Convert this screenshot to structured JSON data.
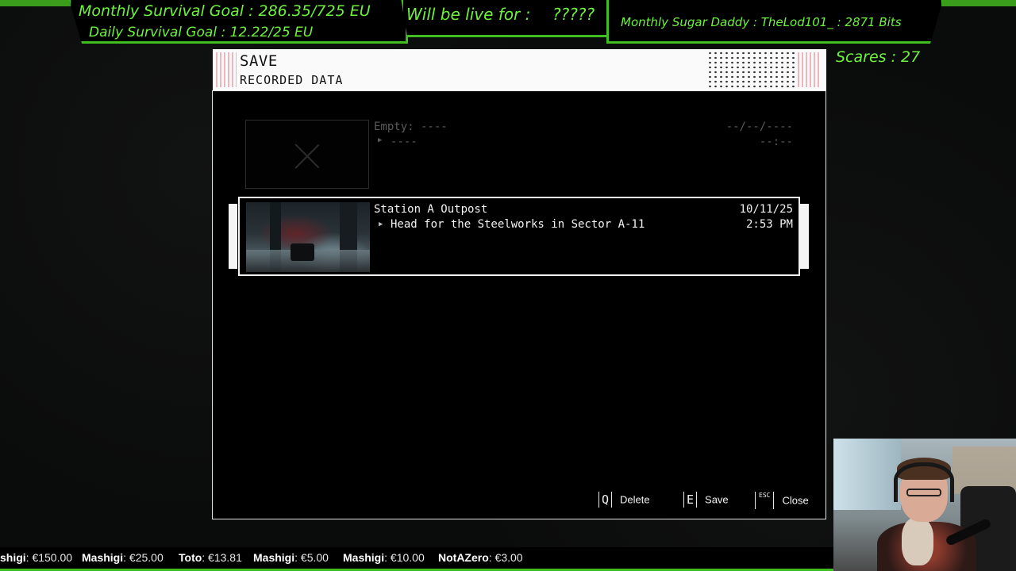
{
  "overlay": {
    "monthly_goal": "Monthly Survival Goal : 286.35/725 EU",
    "daily_goal": "Daily Survival Goal : 12.22/25 EU",
    "live_label": "Will be live for :",
    "live_value": "?????",
    "sugar_daddy": "Monthly Sugar Daddy : TheLod101_ : 2871 Bits",
    "scares": "Scares : 27",
    "accent_color": "#3fbf1f"
  },
  "dialog": {
    "title": "SAVE",
    "subtitle": "RECORDED DATA",
    "slots": [
      {
        "state": "empty",
        "name": "Empty: ----",
        "objective": "----",
        "objective_arrow": "▶",
        "date": "--/--/----",
        "time": "--:--"
      },
      {
        "state": "filled",
        "name": "Station A Outpost",
        "objective": "Head for the Steelworks in Sector A-11",
        "objective_arrow": "▶",
        "date": "10/11/25",
        "time": "2:53 PM"
      }
    ],
    "actions": [
      {
        "key": "Q",
        "label": "Delete"
      },
      {
        "key": "E",
        "label": "Save"
      },
      {
        "key": "ESC",
        "label": "Close"
      }
    ]
  },
  "ticker": {
    "items": [
      {
        "name": "shigi",
        "amount": ": €150.00"
      },
      {
        "name": "Mashigi",
        "amount": ": €25.00"
      },
      {
        "name": "Toto",
        "amount": ": €13.81"
      },
      {
        "name": "Mashigi",
        "amount": ": €5.00"
      },
      {
        "name": "Mashigi",
        "amount": ": €10.00"
      },
      {
        "name": "NotAZero",
        "amount": ": €3.00"
      }
    ]
  }
}
